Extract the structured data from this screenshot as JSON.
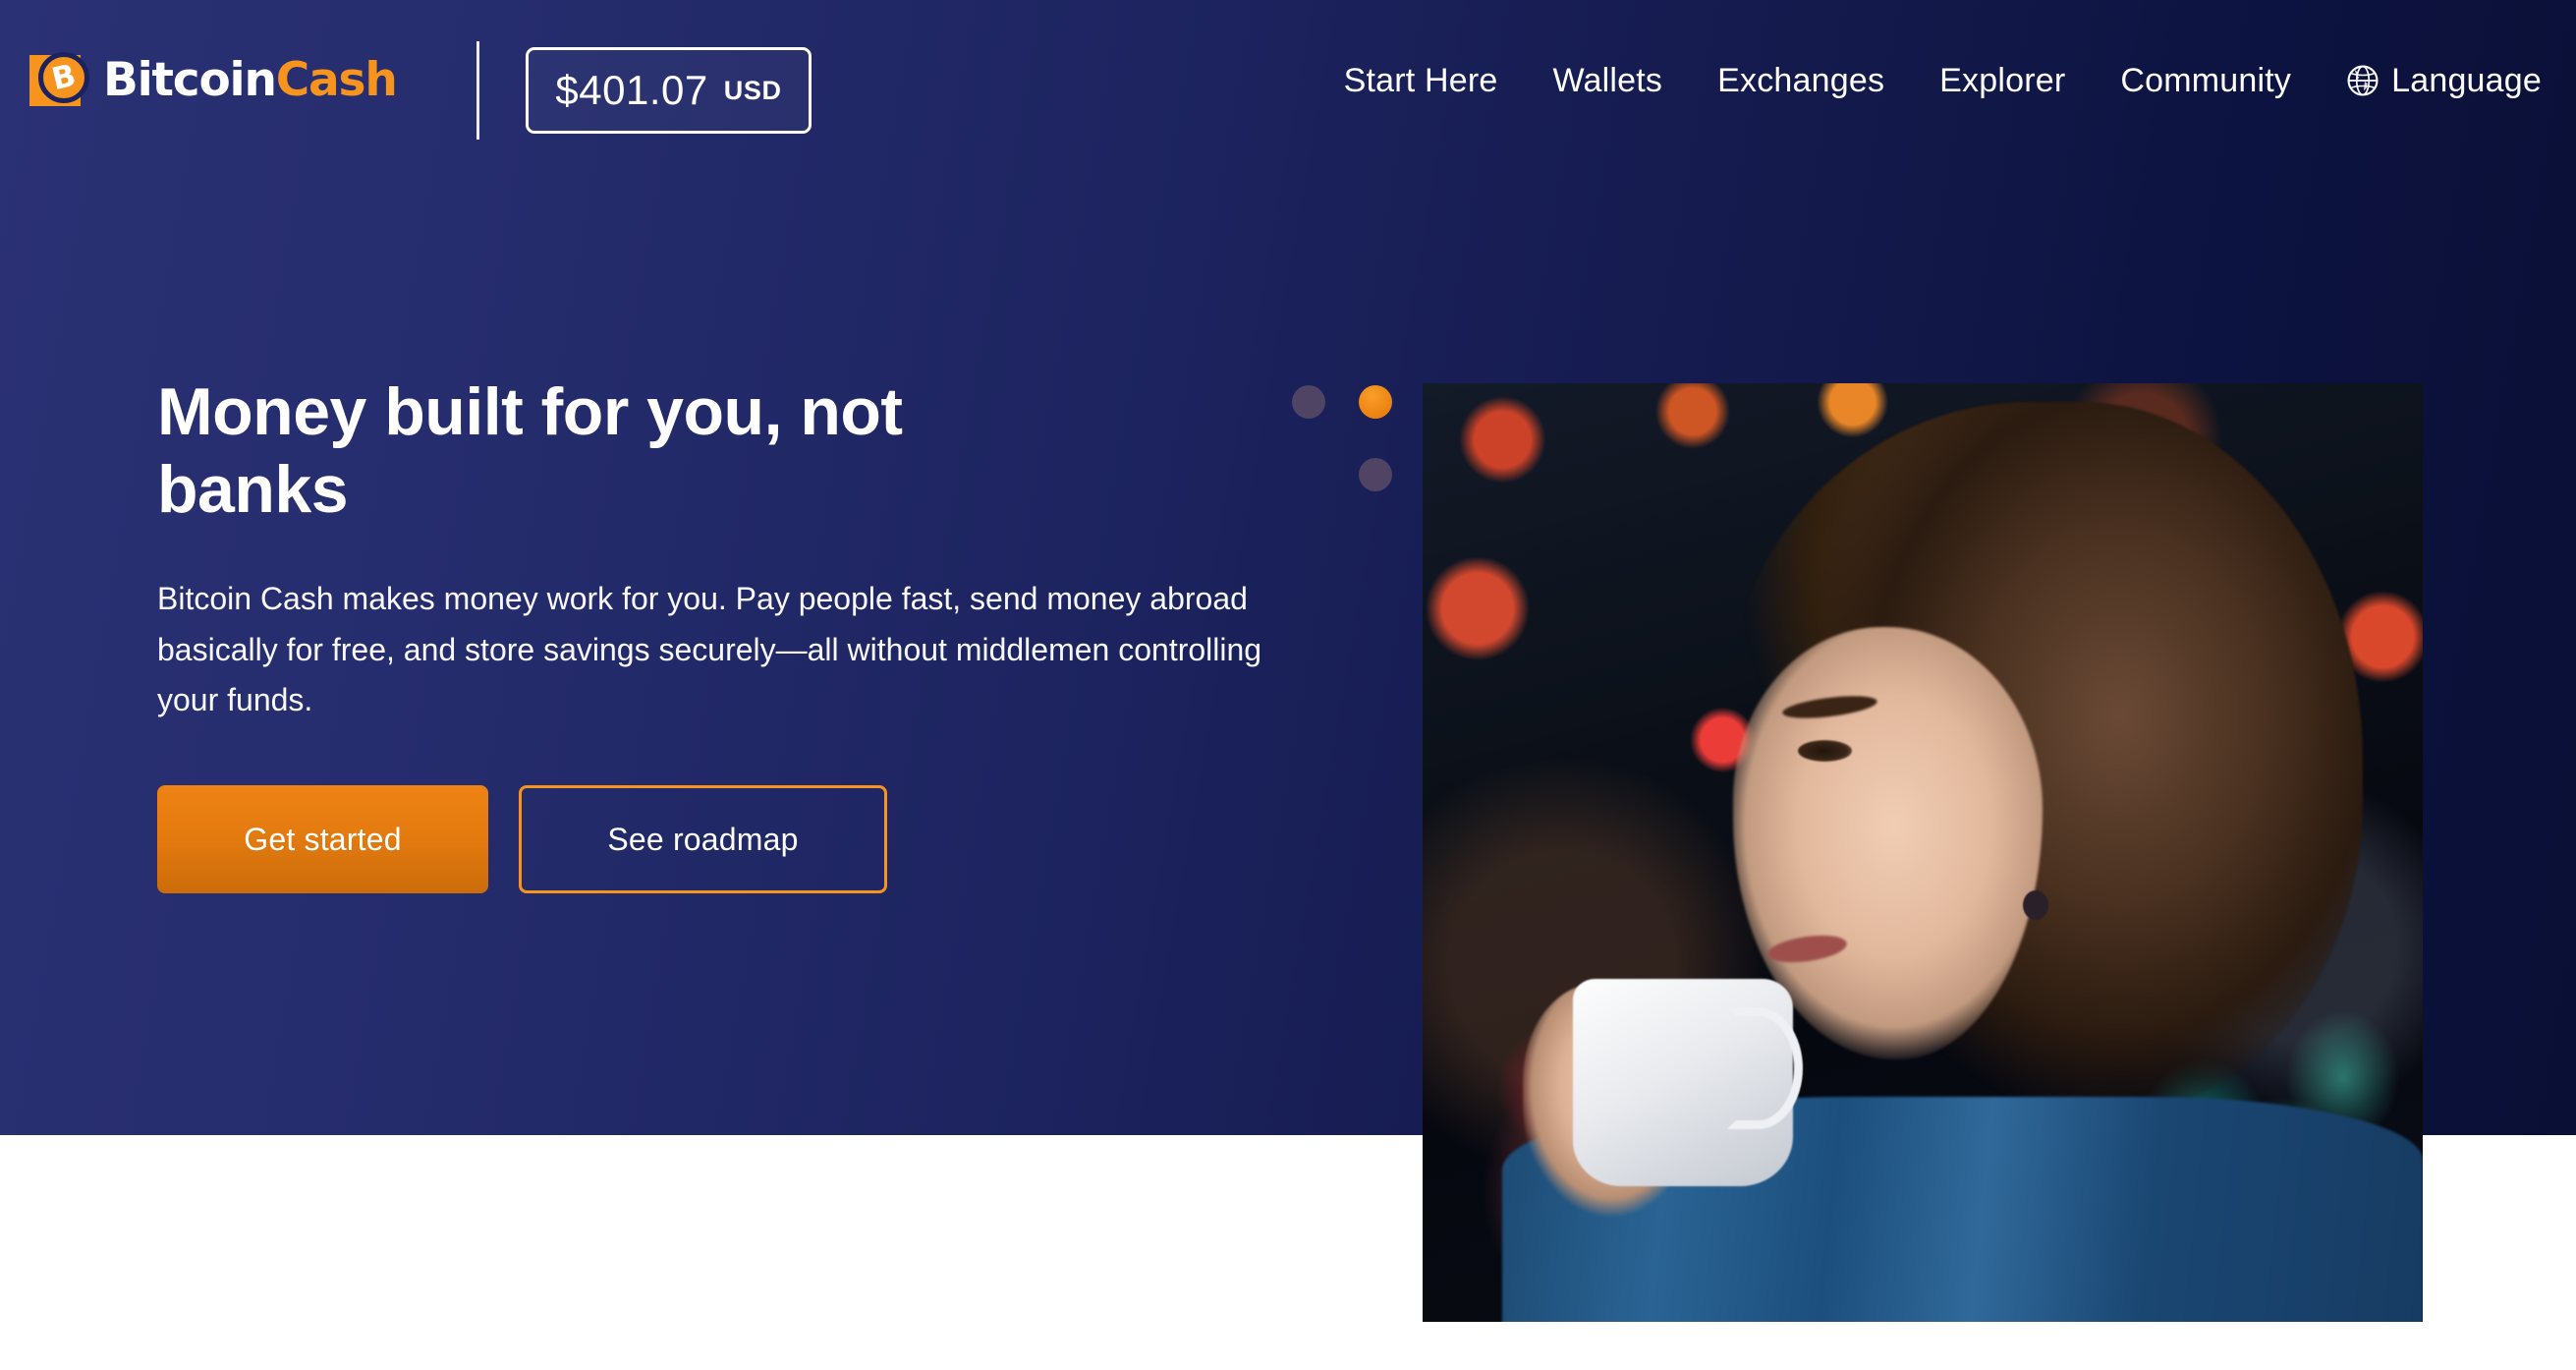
{
  "header": {
    "brand": {
      "logo_icon": "bitcoin-cash-logo-icon",
      "name_part1": "Bitcoin",
      "name_part2": "Cash"
    },
    "price": {
      "value": "$401.07",
      "currency": "USD"
    },
    "nav": [
      {
        "label": "Start Here"
      },
      {
        "label": "Wallets"
      },
      {
        "label": "Exchanges"
      },
      {
        "label": "Explorer"
      },
      {
        "label": "Community"
      }
    ],
    "language": {
      "label": "Language",
      "icon": "globe-icon"
    }
  },
  "hero": {
    "title": "Money built for you, not banks",
    "subtitle": "Bitcoin Cash makes money work for you. Pay people fast, send money abroad basically for free, and store savings securely—all without middlemen controlling your funds.",
    "primary_button": "Get started",
    "secondary_button": "See roadmap",
    "image_alt": "Woman in denim jacket drinking from a white coffee cup in a cafe"
  },
  "colors": {
    "bg_gradient_start": "#2a3174",
    "bg_gradient_end": "#0a0f35",
    "accent_orange": "#f7941d",
    "button_orange": "#e47b10",
    "text_white": "#ffffff"
  }
}
